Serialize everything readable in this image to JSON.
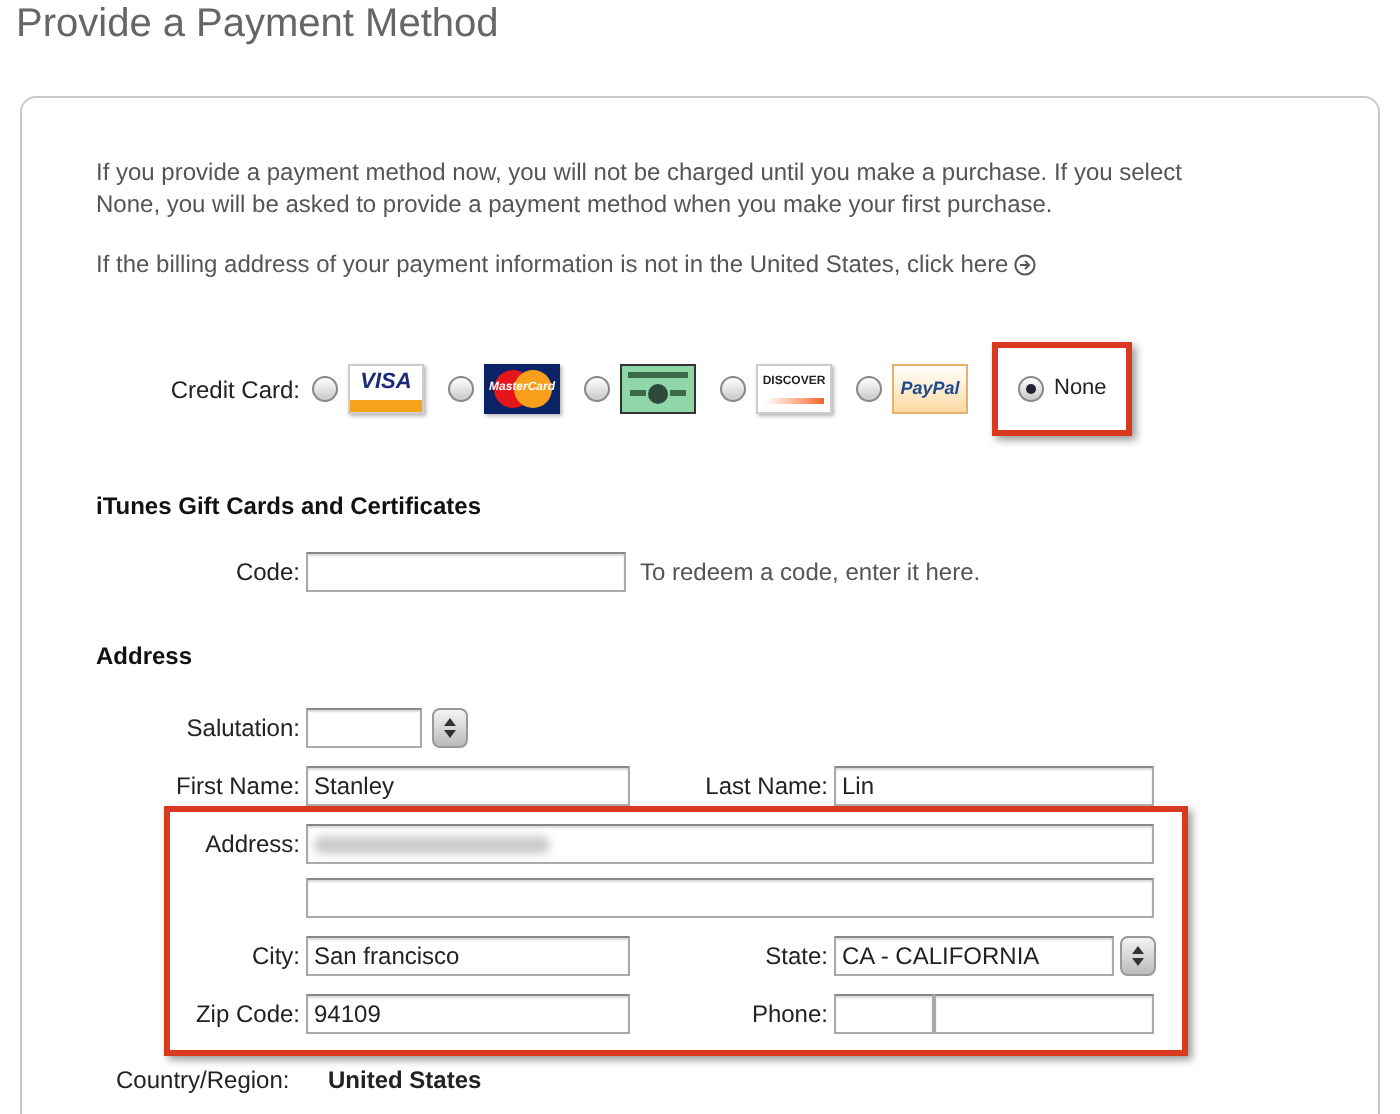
{
  "title": "Provide a Payment Method",
  "intro": "If you provide a payment method now, you will not be charged until you make a purchase. If you select None, you will be asked to provide a payment method when you make your first purchase.",
  "billing_note": "If the billing address of your payment information is not in the United States, click here",
  "payment": {
    "label": "Credit Card:",
    "options": [
      {
        "kind": "visa",
        "logo_text": "VISA",
        "selected": false
      },
      {
        "kind": "mastercard",
        "logo_text": "MasterCard",
        "selected": false
      },
      {
        "kind": "amex",
        "selected": false
      },
      {
        "kind": "discover",
        "logo_text": "DISCOVER",
        "selected": false
      },
      {
        "kind": "paypal",
        "logo_text": "PayPal",
        "selected": false
      },
      {
        "kind": "none",
        "label": "None",
        "selected": true,
        "highlighted": true
      }
    ]
  },
  "gift": {
    "heading": "iTunes Gift Cards and Certificates",
    "code_label": "Code:",
    "hint": "To redeem a code, enter it here."
  },
  "address": {
    "heading": "Address",
    "highlighted": true,
    "salutation_label": "Salutation:",
    "first_name": {
      "label": "First Name:",
      "value": "Stanley"
    },
    "last_name": {
      "label": "Last Name:",
      "value": "Lin"
    },
    "address_label": "Address:",
    "city": {
      "label": "City:",
      "value": "San francisco"
    },
    "state": {
      "label": "State:",
      "value": "CA - CALIFORNIA"
    },
    "zip": {
      "label": "Zip Code:",
      "value": "94109"
    },
    "phone_label": "Phone:",
    "country": {
      "label": "Country/Region:",
      "value": "United States"
    }
  }
}
